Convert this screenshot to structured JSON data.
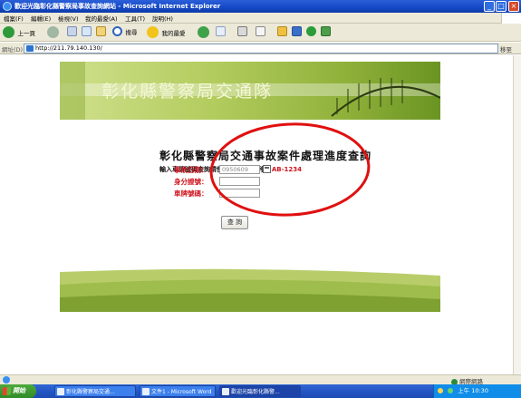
{
  "window": {
    "title": "歡迎光臨彰化縣警察局事故查詢網站 - Microsoft Internet Explorer",
    "min_label": "_",
    "max_label": "□",
    "close_label": "×"
  },
  "menubar": {
    "items": [
      "檔案(F)",
      "編輯(E)",
      "檢視(V)",
      "我的最愛(A)",
      "工具(T)",
      "說明(H)"
    ]
  },
  "toolbar": {
    "back_label": "上一頁",
    "search_label": "搜尋",
    "favorites_label": "我的最愛"
  },
  "address": {
    "label": "網址(D)",
    "url": "http://211.79.140.130/",
    "go_label": "移至"
  },
  "banner": {
    "text": "彰化縣警察局交通隊"
  },
  "page": {
    "title": "彰化縣警察局交通事故案件處理進度查詢",
    "hint": "輸入車牌號碼查詢請使用大寫英文 例如",
    "hint_example": "AB-1234"
  },
  "form": {
    "date_label": "事故日期：",
    "date_value": "0950609",
    "id_label": "身分證號：",
    "id_value": "",
    "plate_label": "車牌號碼：",
    "plate_value": "",
    "submit_label": "查 詢"
  },
  "statusbar": {
    "zone_label": "網際網路"
  },
  "taskbar": {
    "start_label": "開始",
    "tasks": [
      "彰化縣警察局交通...",
      "文件1 - Microsoft Word",
      "歡迎光臨彰化縣警..."
    ],
    "clock": "上午 10:30"
  },
  "colors": {
    "form_label": "#d0141e",
    "annotation_circle": "#e01010",
    "banner_green": "#8fb13a"
  }
}
